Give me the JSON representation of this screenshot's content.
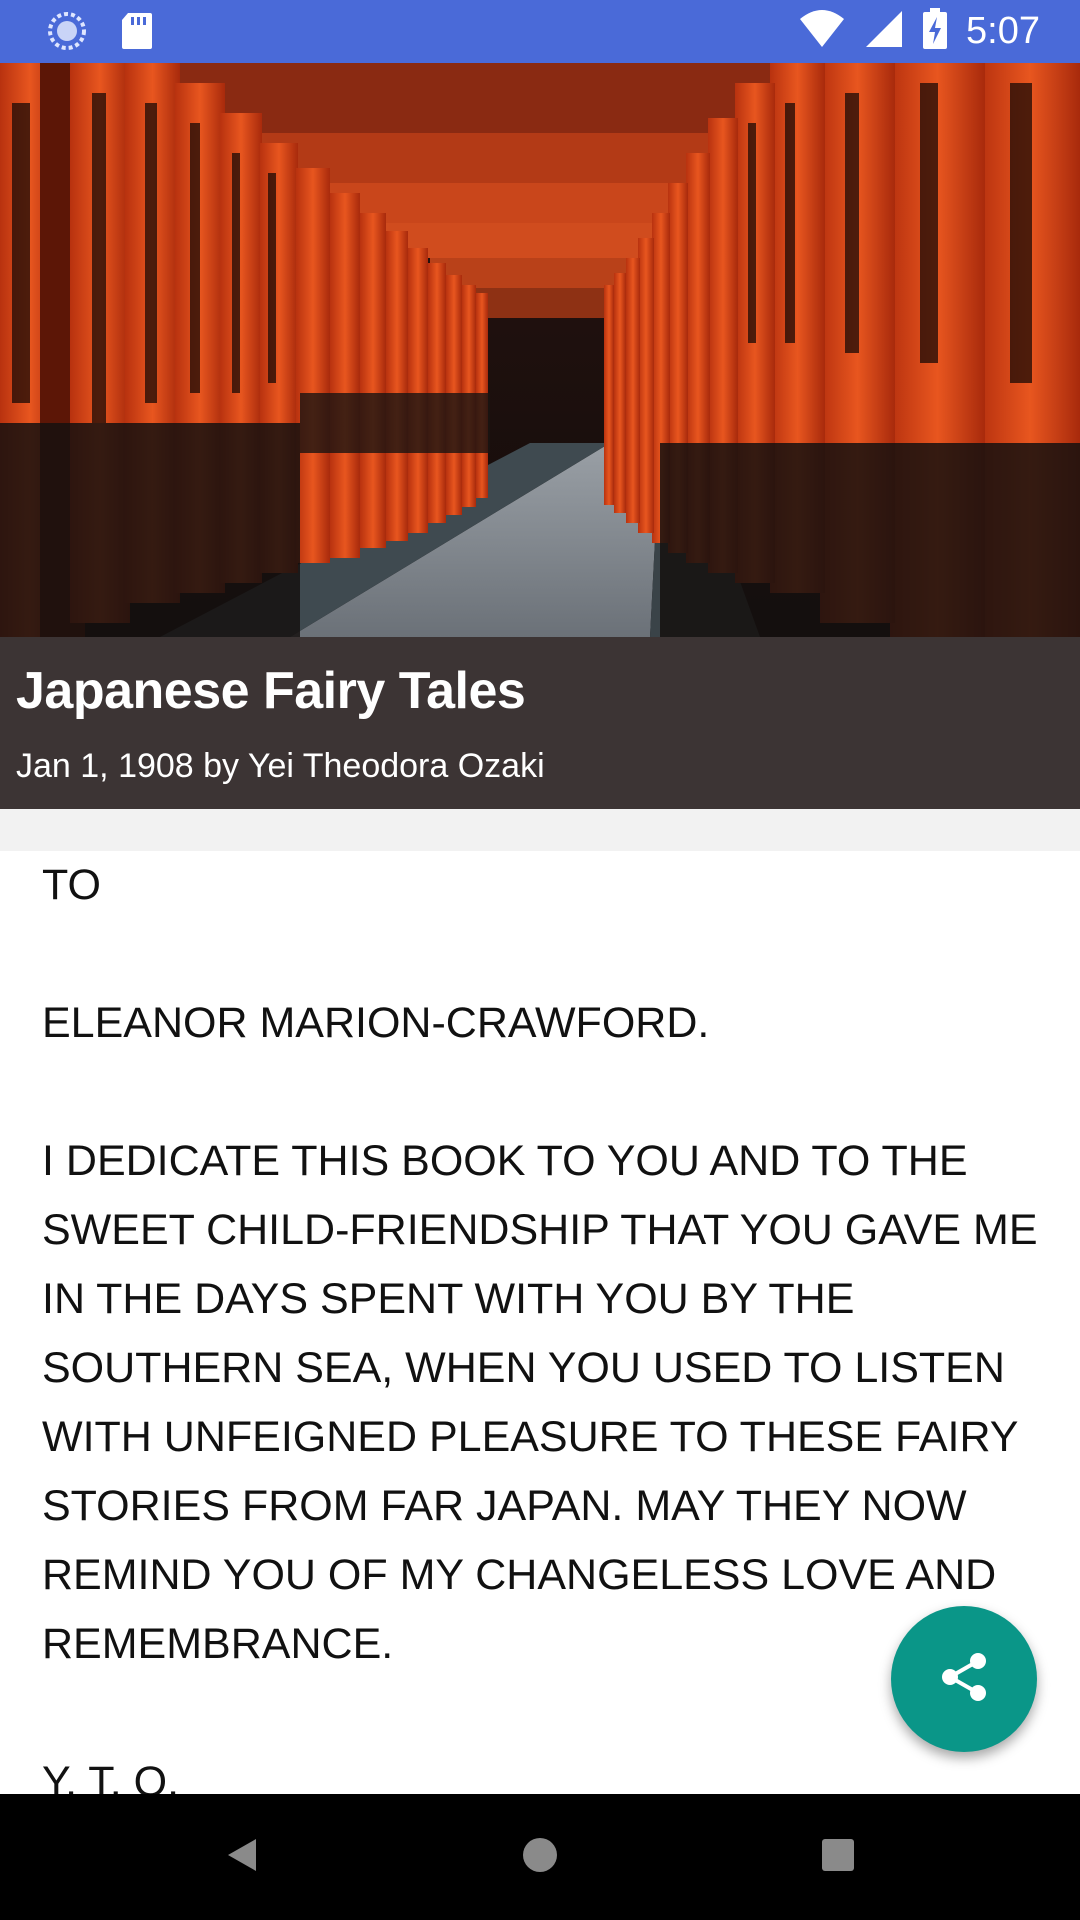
{
  "status_bar": {
    "time": "5:07",
    "icons": [
      "sync-icon",
      "sd-card-icon",
      "wifi-icon",
      "signal-icon",
      "battery-charging-icon"
    ],
    "background": "#4a6ad8"
  },
  "hero": {
    "image": "torii-gates-corridor-photo"
  },
  "book": {
    "title": "Japanese Fairy Tales",
    "meta": "Jan 1, 1908 by Yei Theodora Ozaki"
  },
  "content": {
    "paragraphs": [
      "TO",
      "ELEANOR MARION-CRAWFORD.",
      "I DEDICATE THIS BOOK TO YOU AND TO THE SWEET CHILD-FRIENDSHIP THAT YOU GAVE ME IN THE DAYS SPENT WITH YOU BY THE SOUTHERN SEA, WHEN YOU USED TO LISTEN WITH UNFEIGNED PLEASURE TO THESE FAIRY STORIES FROM FAR JAPAN. MAY THEY NOW REMIND YOU OF MY CHANGELESS LOVE AND REMEMBRANCE.",
      "Y. T. O."
    ]
  },
  "fab": {
    "icon": "share-icon",
    "color": "#0a9688"
  },
  "nav_bar": {
    "buttons": [
      "back-icon",
      "home-icon",
      "recents-icon"
    ]
  }
}
